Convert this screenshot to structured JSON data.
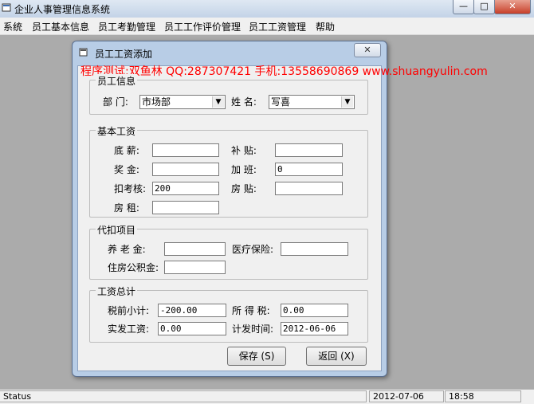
{
  "app": {
    "title": "企业人事管理信息系统"
  },
  "window_controls": {
    "minimize": "—",
    "maximize": "□",
    "close": "✕"
  },
  "menu": [
    "系统",
    "员工基本信息",
    "员工考勤管理",
    "员工工作评价管理",
    "员工工资管理",
    "帮助"
  ],
  "dialog": {
    "title": "员工工资添加",
    "close": "✕",
    "watermark": "程序测试:双鱼林 QQ:287307421 手机:13558690869 www.shuangyulin.com",
    "employee_info": {
      "legend": "员工信息",
      "dept_label": "部  门:",
      "dept_value": "市场部",
      "name_label": "姓  名:",
      "name_value": "写喜"
    },
    "base_salary": {
      "legend": "基本工资",
      "base_label": "底  薪:",
      "base_value": "",
      "subsidy_label": "补  贴:",
      "subsidy_value": "",
      "bonus_label": "奖  金:",
      "bonus_value": "",
      "overtime_label": "加  班:",
      "overtime_value": "0",
      "attendance_label": "扣考核:",
      "attendance_value": "200",
      "housing_label": "房  贴:",
      "housing_value": "",
      "rent_label": "房  租:",
      "rent_value": ""
    },
    "deductions": {
      "legend": "代扣项目",
      "pension_label": "养 老 金:",
      "pension_value": "",
      "medical_label": "医疗保险:",
      "medical_value": "",
      "fund_label": "住房公积金:",
      "fund_value": ""
    },
    "total": {
      "legend": "工资总计",
      "pretax_label": "税前小计:",
      "pretax_value": "-200.00",
      "tax_label": "所 得 税:",
      "tax_value": "0.00",
      "net_label": "实发工资:",
      "net_value": "0.00",
      "date_label": "计发时间:",
      "date_value": "2012-06-06"
    },
    "save_button": "保存 (S)",
    "back_button": "返回 (X)"
  },
  "status": {
    "text": "Status",
    "date": "2012-07-06",
    "time": "18:58"
  }
}
